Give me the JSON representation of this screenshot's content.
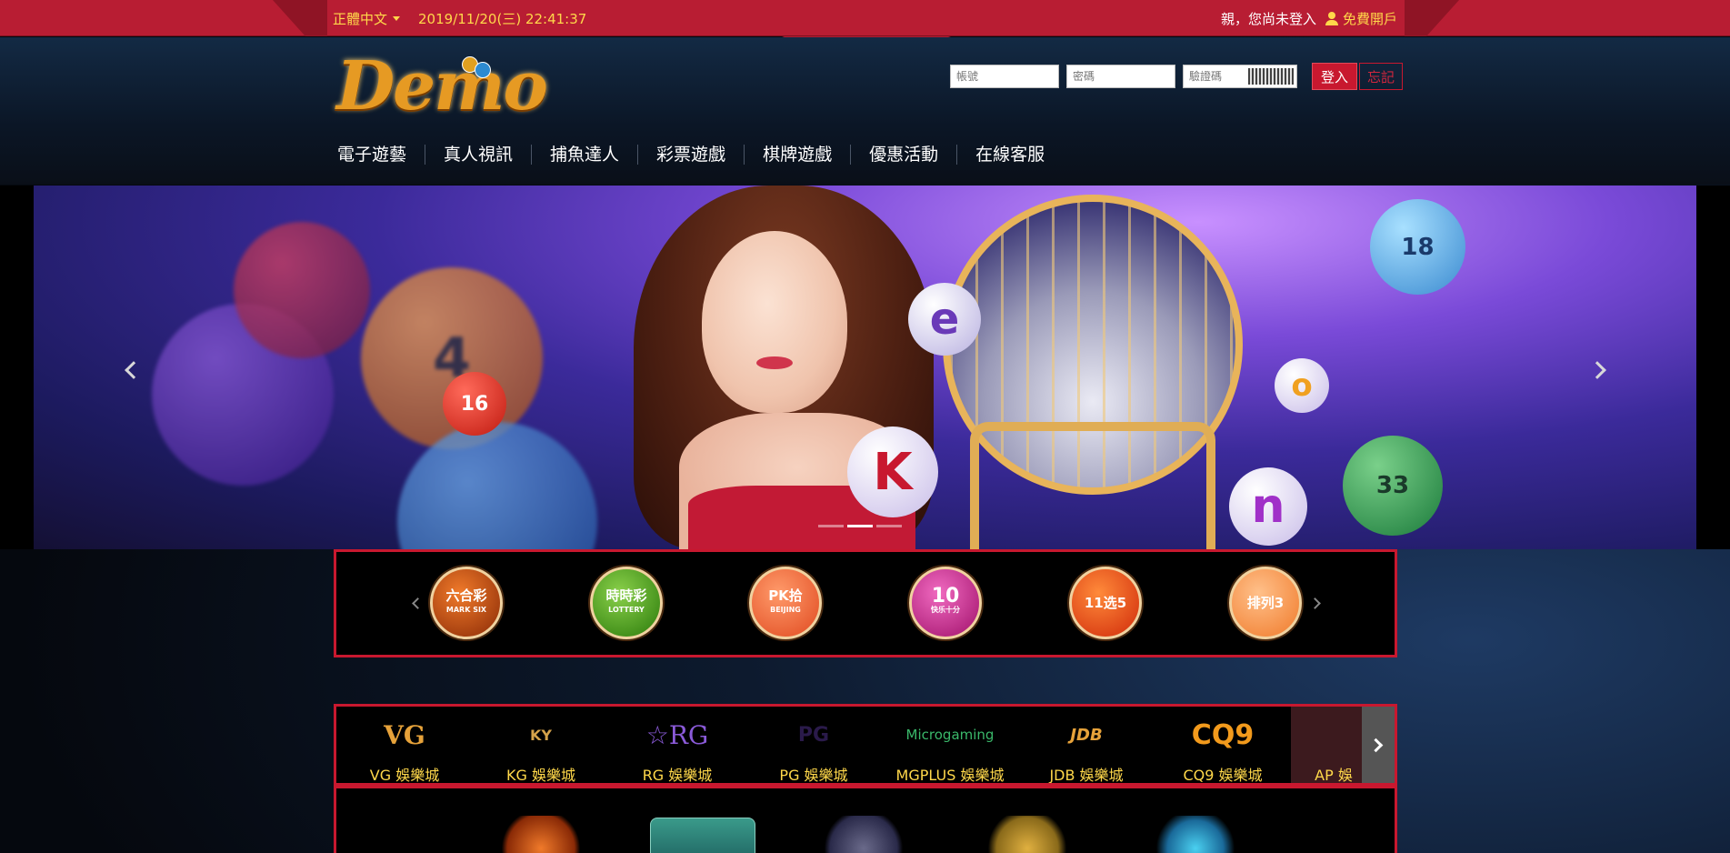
{
  "topbar": {
    "language": "正體中文",
    "datetime": "2019/11/20(三) 22:41:37",
    "greeting": "親，您尚未登入",
    "signup": "免費開戶"
  },
  "logo": {
    "text": "Demo"
  },
  "login": {
    "username_placeholder": "帳號",
    "password_placeholder": "密碼",
    "captcha_placeholder": "驗證碼",
    "login_label": "登入",
    "forget_label": "忘記"
  },
  "nav": {
    "items": [
      "電子遊藝",
      "真人視訊",
      "捕魚達人",
      "彩票遊戲",
      "棋牌遊戲",
      "優惠活動",
      "在線客服"
    ]
  },
  "banner": {
    "balls": [
      "16",
      "e",
      "K",
      "n",
      "18",
      "33",
      "o",
      "4"
    ],
    "slides": 3,
    "active_slide": 2
  },
  "lottery": {
    "items": [
      {
        "line1": "六合彩",
        "line2": "MARK SIX",
        "color": "#c24a0e"
      },
      {
        "line1": "時時彩",
        "line2": "LOTTERY",
        "color": "#4aa21c"
      },
      {
        "line1": "PK拾",
        "line2": "BEIJING",
        "color": "#f05a30"
      },
      {
        "line1": "10",
        "line2": "快乐十分",
        "color": "#c0208a"
      },
      {
        "line1": "11选5",
        "line2": "",
        "color": "#e24a16"
      },
      {
        "line1": "排列3",
        "line2": "",
        "color": "#f07a2a"
      }
    ]
  },
  "platforms": {
    "items": [
      {
        "logo": "VG",
        "label": "VG 娛樂城",
        "color": "#e6a23a"
      },
      {
        "logo": "KY",
        "label": "KG 娛樂城",
        "color": "#d4a24a"
      },
      {
        "logo": "☆RG",
        "label": "RG 娛樂城",
        "color": "#8a5ad8"
      },
      {
        "logo": "PG",
        "label": "PG 娛樂城",
        "color": "#7a3ab8"
      },
      {
        "logo": "Microgaming",
        "label": "MGPLUS 娛樂城",
        "color": "#3ab86a"
      },
      {
        "logo": "JDB",
        "label": "JDB 娛樂城",
        "color": "#e6a23a"
      },
      {
        "logo": "CQ9",
        "label": "CQ9 娛樂城",
        "color": "#f29a1c"
      },
      {
        "logo": "",
        "label": "AP 娛",
        "color": "#c8182f"
      }
    ]
  },
  "colors": {
    "primary": "#c8182f",
    "accent": "#ffd84a"
  }
}
